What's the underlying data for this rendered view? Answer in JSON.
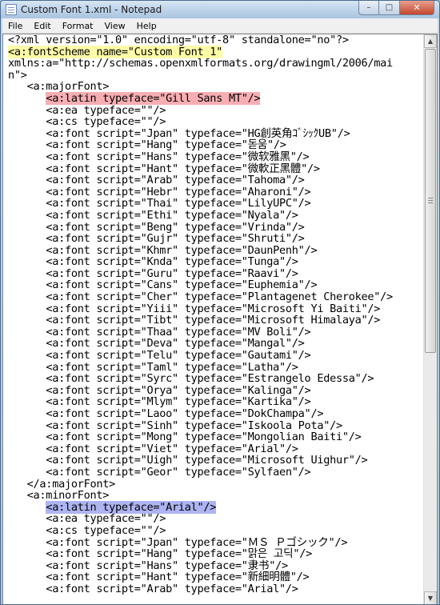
{
  "window": {
    "title": "Custom Font 1.xml - Notepad",
    "minimize_glyph": "–",
    "maximize_glyph": "□",
    "close_glyph": "✕"
  },
  "menu": [
    "File",
    "Edit",
    "Format",
    "View",
    "Help"
  ],
  "editor": {
    "lines": [
      {
        "text": "<?xml version=\"1.0\" encoding=\"utf-8\" standalone=\"no\"?>",
        "indent": 0
      },
      {
        "text": "<a:fontScheme name=\"Custom Font 1\"",
        "indent": 0,
        "highlight": "yellow"
      },
      {
        "text": "xmlns:a=\"http://schemas.openxmlformats.org/drawingml/2006/mai",
        "indent": 0
      },
      {
        "text": "n\">",
        "indent": 0
      },
      {
        "text": "<a:majorFont>",
        "indent": 3
      },
      {
        "text": "<a:latin typeface=\"Gill Sans MT\"/>",
        "indent": 6,
        "highlight": "pink"
      },
      {
        "text": "<a:ea typeface=\"\"/>",
        "indent": 6
      },
      {
        "text": "<a:cs typeface=\"\"/>",
        "indent": 6
      },
      {
        "text": "<a:font script=\"Jpan\" typeface=\"HG創英角ｺﾞｼｯｸUB\"/>",
        "indent": 6
      },
      {
        "text": "<a:font script=\"Hang\" typeface=\"돋움\"/>",
        "indent": 6
      },
      {
        "text": "<a:font script=\"Hans\" typeface=\"微软雅黑\"/>",
        "indent": 6
      },
      {
        "text": "<a:font script=\"Hant\" typeface=\"微軟正黑體\"/>",
        "indent": 6
      },
      {
        "text": "<a:font script=\"Arab\" typeface=\"Tahoma\"/>",
        "indent": 6
      },
      {
        "text": "<a:font script=\"Hebr\" typeface=\"Aharoni\"/>",
        "indent": 6
      },
      {
        "text": "<a:font script=\"Thai\" typeface=\"LilyUPC\"/>",
        "indent": 6
      },
      {
        "text": "<a:font script=\"Ethi\" typeface=\"Nyala\"/>",
        "indent": 6
      },
      {
        "text": "<a:font script=\"Beng\" typeface=\"Vrinda\"/>",
        "indent": 6
      },
      {
        "text": "<a:font script=\"Gujr\" typeface=\"Shruti\"/>",
        "indent": 6
      },
      {
        "text": "<a:font script=\"Khmr\" typeface=\"DaunPenh\"/>",
        "indent": 6
      },
      {
        "text": "<a:font script=\"Knda\" typeface=\"Tunga\"/>",
        "indent": 6
      },
      {
        "text": "<a:font script=\"Guru\" typeface=\"Raavi\"/>",
        "indent": 6
      },
      {
        "text": "<a:font script=\"Cans\" typeface=\"Euphemia\"/>",
        "indent": 6
      },
      {
        "text": "<a:font script=\"Cher\" typeface=\"Plantagenet Cherokee\"/>",
        "indent": 6
      },
      {
        "text": "<a:font script=\"Yiii\" typeface=\"Microsoft Yi Baiti\"/>",
        "indent": 6
      },
      {
        "text": "<a:font script=\"Tibt\" typeface=\"Microsoft Himalaya\"/>",
        "indent": 6
      },
      {
        "text": "<a:font script=\"Thaa\" typeface=\"MV Boli\"/>",
        "indent": 6
      },
      {
        "text": "<a:font script=\"Deva\" typeface=\"Mangal\"/>",
        "indent": 6
      },
      {
        "text": "<a:font script=\"Telu\" typeface=\"Gautami\"/>",
        "indent": 6
      },
      {
        "text": "<a:font script=\"Taml\" typeface=\"Latha\"/>",
        "indent": 6
      },
      {
        "text": "<a:font script=\"Syrc\" typeface=\"Estrangelo Edessa\"/>",
        "indent": 6
      },
      {
        "text": "<a:font script=\"Orya\" typeface=\"Kalinga\"/>",
        "indent": 6
      },
      {
        "text": "<a:font script=\"Mlym\" typeface=\"Kartika\"/>",
        "indent": 6
      },
      {
        "text": "<a:font script=\"Laoo\" typeface=\"DokChampa\"/>",
        "indent": 6
      },
      {
        "text": "<a:font script=\"Sinh\" typeface=\"Iskoola Pota\"/>",
        "indent": 6
      },
      {
        "text": "<a:font script=\"Mong\" typeface=\"Mongolian Baiti\"/>",
        "indent": 6
      },
      {
        "text": "<a:font script=\"Viet\" typeface=\"Arial\"/>",
        "indent": 6
      },
      {
        "text": "<a:font script=\"Uigh\" typeface=\"Microsoft Uighur\"/>",
        "indent": 6
      },
      {
        "text": "<a:font script=\"Geor\" typeface=\"Sylfaen\"/>",
        "indent": 6
      },
      {
        "text": "</a:majorFont>",
        "indent": 3
      },
      {
        "text": "<a:minorFont>",
        "indent": 3
      },
      {
        "text": "<a:latin typeface=\"Arial\"/>",
        "indent": 6,
        "highlight": "blue"
      },
      {
        "text": "<a:ea typeface=\"\"/>",
        "indent": 6
      },
      {
        "text": "<a:cs typeface=\"\"/>",
        "indent": 6
      },
      {
        "text": "<a:font script=\"Jpan\" typeface=\"ＭＳ Ｐゴシック\"/>",
        "indent": 6
      },
      {
        "text": "<a:font script=\"Hang\" typeface=\"맑은 고딕\"/>",
        "indent": 6
      },
      {
        "text": "<a:font script=\"Hans\" typeface=\"隶书\"/>",
        "indent": 6
      },
      {
        "text": "<a:font script=\"Hant\" typeface=\"新細明體\"/>",
        "indent": 6
      },
      {
        "text": "<a:font script=\"Arab\" typeface=\"Arial\"/>",
        "indent": 6
      }
    ]
  },
  "scrollbar": {
    "up_glyph": "▲",
    "down_glyph": "▼"
  }
}
